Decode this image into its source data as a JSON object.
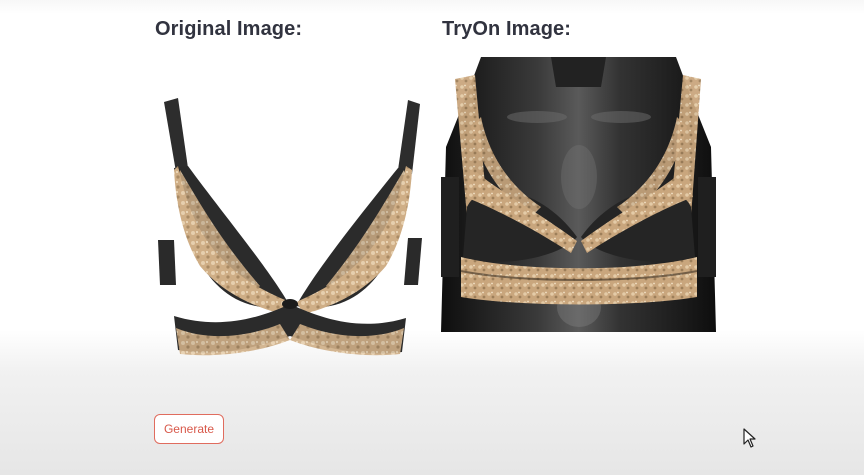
{
  "original": {
    "heading": "Original Image:"
  },
  "tryon": {
    "heading": "TryOn Image:"
  },
  "actions": {
    "generate_label": "Generate"
  },
  "colors": {
    "heading_text": "#31333f",
    "button_accent": "#e06c5e",
    "lace": "#d2b48f",
    "fabric": "#2b2b2b",
    "mannequin": "#1a1a1a"
  },
  "icons": {
    "cursor": "mouse-pointer-icon"
  }
}
